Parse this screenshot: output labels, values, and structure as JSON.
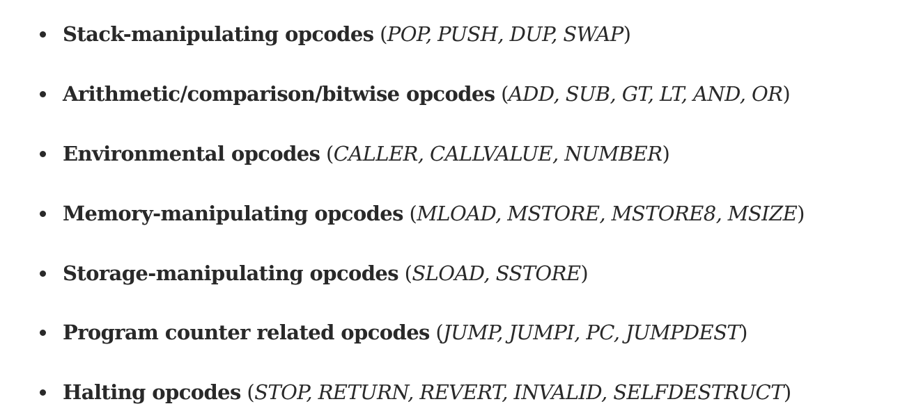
{
  "list": {
    "items": [
      {
        "name": "Stack-manipulating opcodes",
        "ops": "POP, PUSH, DUP, SWAP"
      },
      {
        "name": "Arithmetic/comparison/bitwise opcodes",
        "ops": "ADD, SUB, GT, LT, AND, OR"
      },
      {
        "name": "Environmental opcodes",
        "ops": "CALLER, CALLVALUE, NUMBER"
      },
      {
        "name": "Memory-manipulating opcodes",
        "ops": "MLOAD, MSTORE, MSTORE8, MSIZE"
      },
      {
        "name": "Storage-manipulating opcodes",
        "ops": "SLOAD, SSTORE"
      },
      {
        "name": "Program counter related opcodes",
        "ops": "JUMP, JUMPI, PC, JUMPDEST"
      },
      {
        "name": "Halting opcodes",
        "ops": "STOP, RETURN, REVERT, INVALID, SELFDESTRUCT"
      }
    ]
  }
}
